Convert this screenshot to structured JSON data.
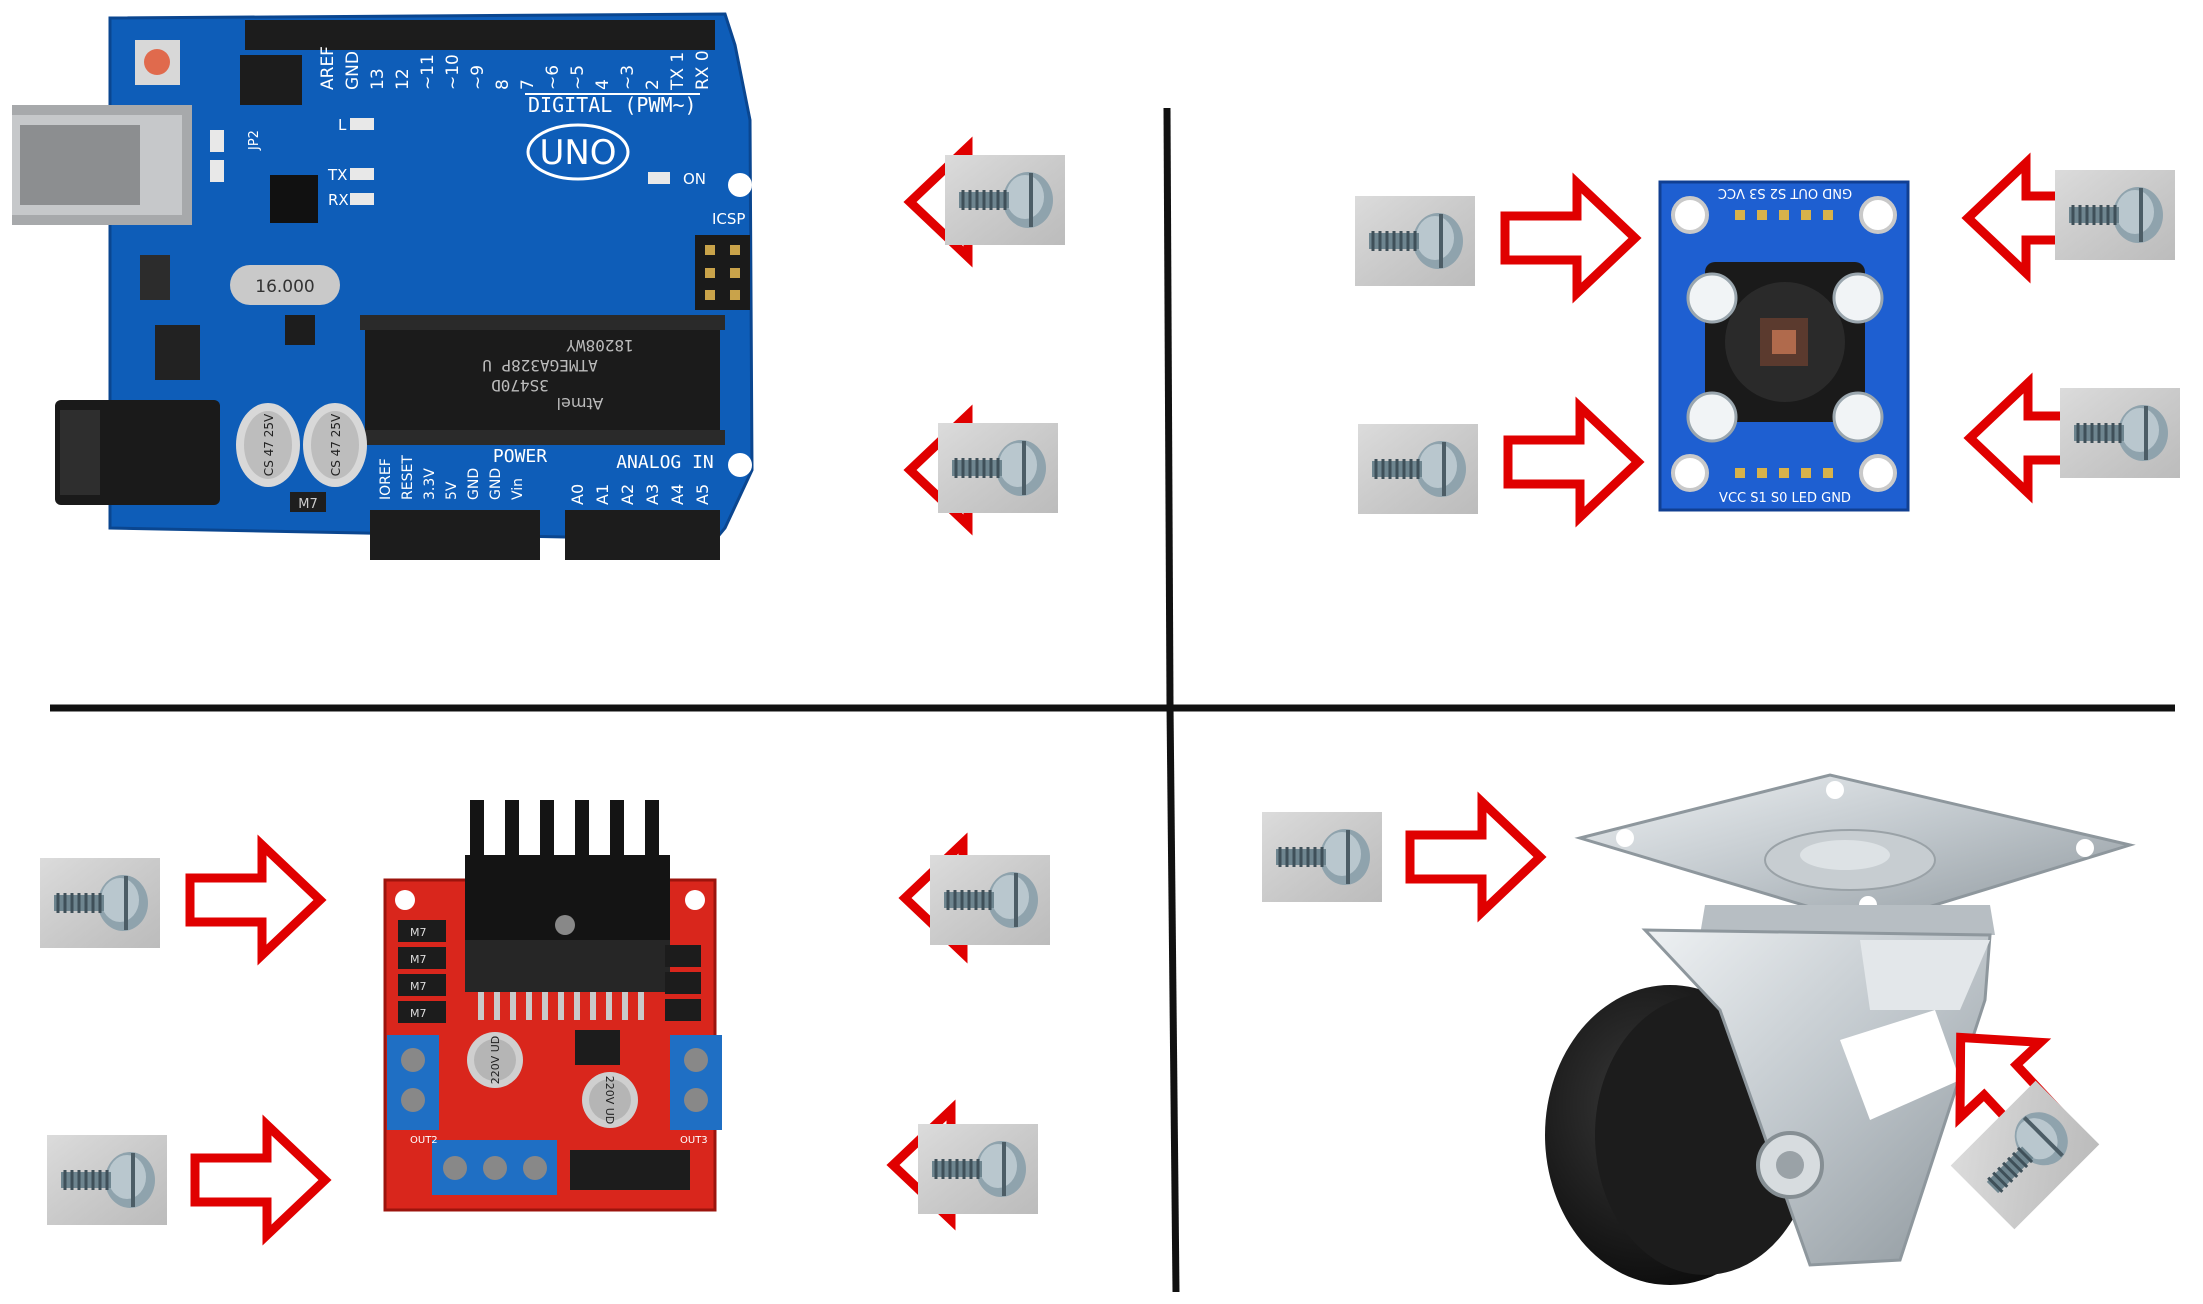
{
  "colors": {
    "background": "#ffffff",
    "divider": "#111111",
    "arrow_outline": "#e00000",
    "arrow_fill": "#ffffff",
    "arduino_board": "#0e5db8",
    "sensor_board": "#1e5fd1",
    "driver_board": "#d9261c",
    "terminal_block": "#1f6fc4",
    "heatsink": "#141414",
    "screw_tile": "#cfcfcf",
    "caster_metal": "#cfd3d6",
    "caster_wheel": "#141414"
  },
  "arduino": {
    "digital_label": "DIGITAL (PWM~)",
    "analog_label": "ANALOG IN",
    "power_label": "POWER",
    "uno_label": "UNO",
    "on_label": "ON",
    "icsp_label": "ICSP",
    "tx_label": "TX",
    "rx_label": "RX",
    "l_label": "L",
    "jp2_label": "JP2",
    "reset_label": "RESET",
    "crystal_label": "16.000",
    "chip_line1": "ATMEGA328P U",
    "chip_line2": "18208WY",
    "chip_line3": "3S470D",
    "chip_brand": "Atmel",
    "cap1": "CS 47 25V",
    "cap2": "CS 47 25V",
    "m7": "M7",
    "digital_pins": [
      "AREF",
      "GND",
      "13",
      "12",
      "~11",
      "~10",
      "~9",
      "8",
      "7",
      "~6",
      "~5",
      "4",
      "~3",
      "2",
      "TX 1",
      "RX 0"
    ],
    "power_pins": [
      "IOREF",
      "RESET",
      "3.3V",
      "5V",
      "GND",
      "GND",
      "Vin"
    ],
    "analog_pins": [
      "A0",
      "A1",
      "A2",
      "A3",
      "A4",
      "A5"
    ]
  },
  "color_sensor": {
    "top_pins": "GND OUT S2 S3 VCC",
    "bottom_pins": "VCC S1 S0 LED GND"
  },
  "motor_driver": {
    "diodes": [
      "M7",
      "M7",
      "M7",
      "M7"
    ],
    "cap_left": "220V UD",
    "cap_right": "220V UD",
    "out_left": "OUT2",
    "out_right": "OUT3"
  },
  "screws": [
    "screw",
    "screw",
    "screw",
    "screw",
    "screw",
    "screw",
    "screw",
    "screw",
    "screw",
    "screw",
    "screw"
  ]
}
